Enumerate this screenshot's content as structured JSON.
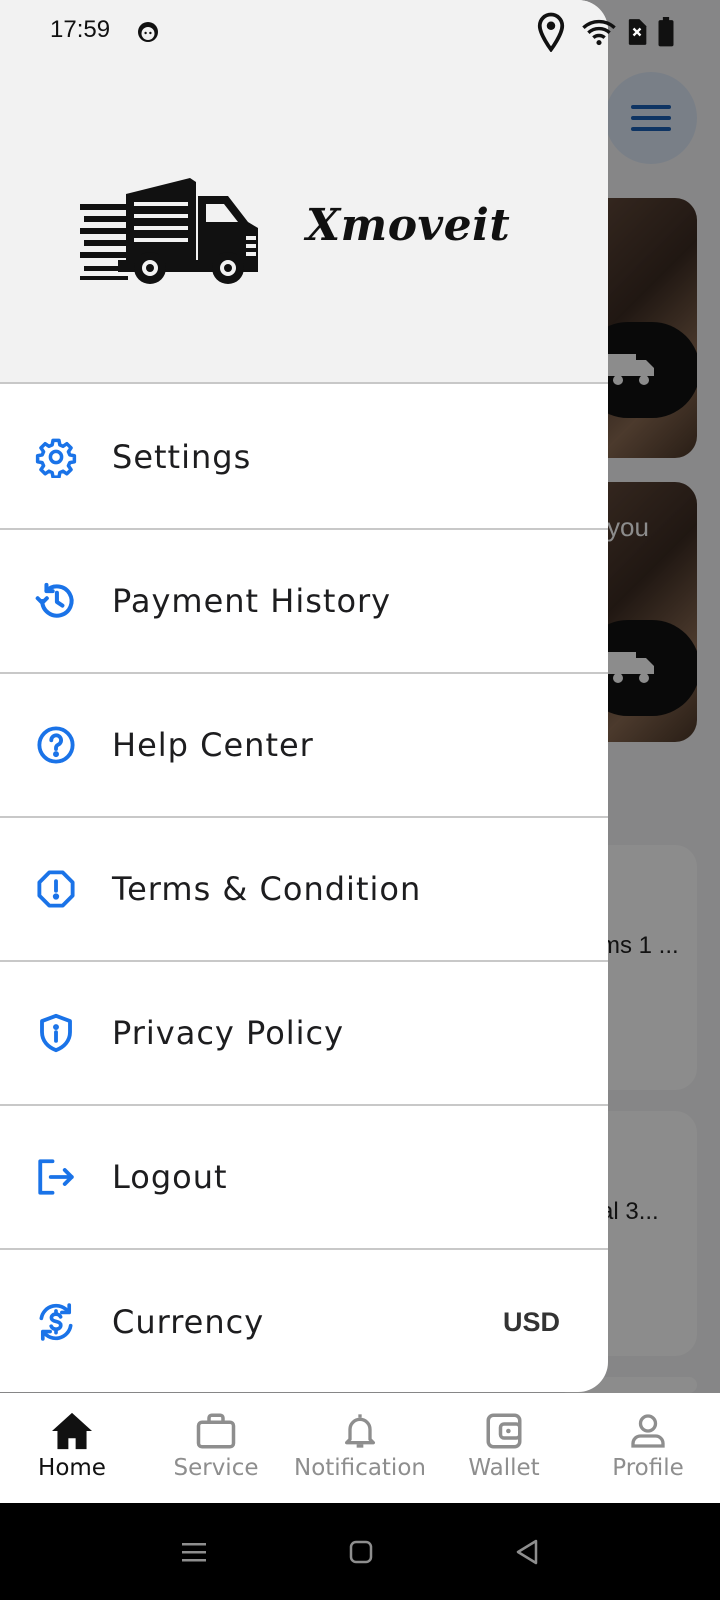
{
  "status_bar": {
    "time": "17:59"
  },
  "background": {
    "card_text": "you",
    "list_item_1": "ms 1 ...",
    "list_item_2": "al 3..."
  },
  "drawer": {
    "brand_name": "Xmoveit",
    "items": [
      {
        "label": "Settings",
        "icon": "gear-icon"
      },
      {
        "label": "Payment History",
        "icon": "history-icon"
      },
      {
        "label": "Help Center",
        "icon": "help-circle-icon"
      },
      {
        "label": "Terms & Condition",
        "icon": "alert-octagon-icon"
      },
      {
        "label": "Privacy Policy",
        "icon": "shield-info-icon"
      },
      {
        "label": "Logout",
        "icon": "logout-icon"
      },
      {
        "label": "Currency",
        "icon": "currency-exchange-icon",
        "value": "USD"
      }
    ]
  },
  "bottom_nav": {
    "items": [
      {
        "label": "Home",
        "icon": "home-icon",
        "active": true
      },
      {
        "label": "Service",
        "icon": "briefcase-icon",
        "active": false
      },
      {
        "label": "Notification",
        "icon": "bell-icon",
        "active": false
      },
      {
        "label": "Wallet",
        "icon": "wallet-icon",
        "active": false
      },
      {
        "label": "Profile",
        "icon": "person-icon",
        "active": false
      }
    ]
  },
  "colors": {
    "accent": "#1a73e8",
    "drawer_header_bg": "#f2f2f2",
    "divider": "#c8c8c8"
  }
}
